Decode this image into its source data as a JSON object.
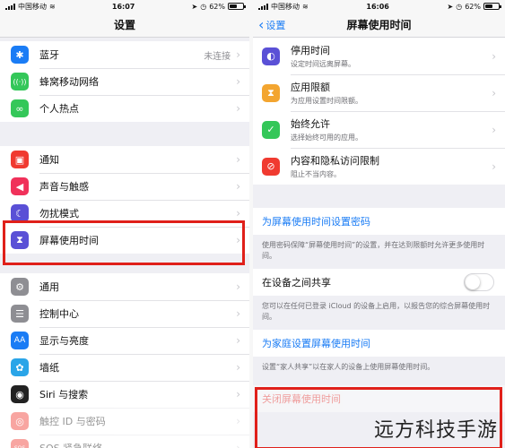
{
  "left": {
    "status": {
      "carrier": "中国移动",
      "time": "16:07",
      "battery": "62%"
    },
    "title": "设置",
    "group1": [
      {
        "label": "蓝牙",
        "value": "未连接",
        "icon": "bluetooth-icon",
        "color": "#1a7cf5",
        "glyph": "✱"
      },
      {
        "label": "蜂窝移动网络",
        "value": "",
        "icon": "antenna-icon",
        "color": "#34c759",
        "glyph": "((·))"
      },
      {
        "label": "个人热点",
        "value": "",
        "icon": "hotspot-icon",
        "color": "#34c759",
        "glyph": "∞"
      }
    ],
    "group2": [
      {
        "label": "通知",
        "icon": "notifications-icon",
        "color": "#f03a30",
        "glyph": "▣"
      },
      {
        "label": "声音与触感",
        "icon": "speaker-icon",
        "color": "#f0315a",
        "glyph": "◀"
      },
      {
        "label": "勿扰模式",
        "icon": "moon-icon",
        "color": "#5a50d6",
        "glyph": "☾"
      },
      {
        "label": "屏幕使用时间",
        "icon": "hourglass-icon",
        "color": "#5a50d6",
        "glyph": "⧗"
      }
    ],
    "group3": [
      {
        "label": "通用",
        "icon": "gear-icon",
        "color": "#8e8e93",
        "glyph": "⚙"
      },
      {
        "label": "控制中心",
        "icon": "sliders-icon",
        "color": "#8e8e93",
        "glyph": "☰"
      },
      {
        "label": "显示与亮度",
        "icon": "text-size-icon",
        "color": "#1a7cf5",
        "glyph": "AA"
      },
      {
        "label": "墙纸",
        "icon": "flower-icon",
        "color": "#2aa5e8",
        "glyph": "✿"
      },
      {
        "label": "Siri 与搜索",
        "icon": "siri-icon",
        "color": "#222",
        "glyph": "◉"
      },
      {
        "label": "触控 ID 与密码",
        "icon": "fingerprint-icon",
        "color": "#f03a30",
        "glyph": "◎"
      },
      {
        "label": "SOS 紧急联络",
        "icon": "sos-icon",
        "color": "#f03a30",
        "glyph": "SOS"
      }
    ]
  },
  "right": {
    "status": {
      "carrier": "中国移动",
      "time": "16:06",
      "battery": "62%"
    },
    "back": "设置",
    "title": "屏幕使用时间",
    "items": [
      {
        "title": "停用时间",
        "subtitle": "设定时间远离屏幕。",
        "icon": "downtime-icon",
        "color": "#5a50d6",
        "glyph": "◐"
      },
      {
        "title": "应用限额",
        "subtitle": "为应用设置时间限额。",
        "icon": "hourglass-icon",
        "color": "#f3a530",
        "glyph": "⧗"
      },
      {
        "title": "始终允许",
        "subtitle": "选择始终可用的应用。",
        "icon": "checkmark-icon",
        "color": "#34c759",
        "glyph": "✓"
      },
      {
        "title": "内容和隐私访问限制",
        "subtitle": "阻止不当内容。",
        "icon": "restrict-icon",
        "color": "#f03a30",
        "glyph": "⊘"
      }
    ],
    "passcode_link": "为屏幕使用时间设置密码",
    "passcode_note": "使用密码保障“屏幕使用时间”的设置，并在达到限额时允许更多使用时间。",
    "share_label": "在设备之间共享",
    "share_note": "您可以在任何已登录 iCloud 的设备上启用，以报告您的综合屏幕使用时间。",
    "family_link": "为家庭设置屏幕使用时间",
    "family_note": "设置“家人共享”以在家人的设备上使用屏幕使用时间。",
    "turn_off": "关闭屏幕使用时间"
  },
  "watermark": "远方科技手游",
  "highlight_color": "#e0201a"
}
